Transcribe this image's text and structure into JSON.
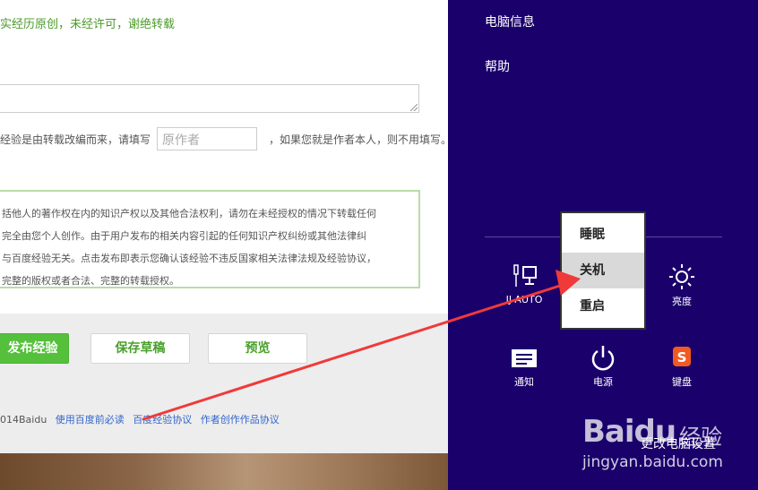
{
  "left_page": {
    "origin_note": "实经历原创，未经许可，谢绝转载",
    "reprint_text_before": "经验是由转载改编而来，请填写",
    "origin_input_placeholder": "原作者",
    "reprint_text_after": "，如果您就是作者本人，则不用填写。",
    "notice_lines": [
      "括他人的著作权在内的知识产权以及其他合法权利，请勿在未经授权的情况下转载任何",
      "完全由您个人创作。由于用户发布的相关内容引起的任何知识产权纠纷或其他法律纠",
      "与百度经验无关。点击发布即表示您确认该经验不违反国家相关法律法规及经验协议，",
      "完整的版权或者合法、完整的转载授权。"
    ],
    "buttons": {
      "publish": "发布经验",
      "save_draft": "保存草稿",
      "preview": "预览"
    },
    "footer": {
      "copyright": "014Baidu",
      "links": [
        "使用百度前必读",
        "百度经验协议",
        "作者创作作品协议"
      ]
    }
  },
  "charm": {
    "pc_info": "电脑信息",
    "help": "帮助",
    "tiles": [
      {
        "label": "IJ-AUTO",
        "icon": "network-icon"
      },
      {
        "label": "亮度",
        "icon": "brightness-icon"
      },
      {
        "label": "通知",
        "icon": "notification-icon"
      },
      {
        "label": "电源",
        "icon": "power-icon"
      },
      {
        "label": "键盘",
        "icon": "keyboard-icon"
      }
    ],
    "power_menu": [
      "睡眠",
      "关机",
      "重启"
    ],
    "power_menu_selected": "关机",
    "change_pc_settings": "更改电脑设置"
  },
  "watermark": {
    "logo": "Baidu",
    "logo_suffix": "经验",
    "site": "jingyan.baidu.com"
  },
  "colors": {
    "charm_bg": "#1a006b",
    "publish_green": "#54c03b",
    "arrow_red": "#f03a3a"
  }
}
